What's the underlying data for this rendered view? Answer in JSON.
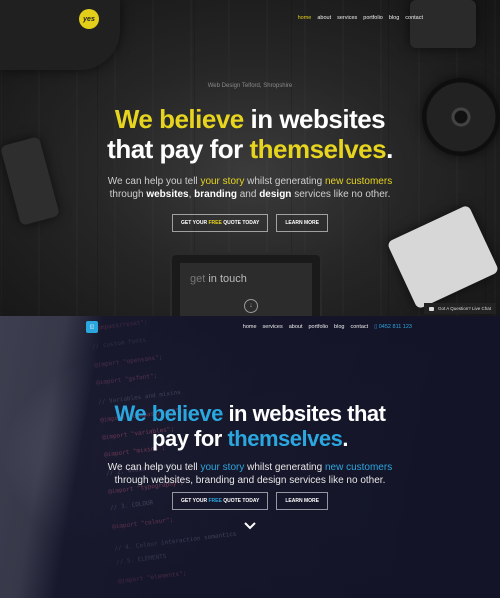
{
  "top": {
    "logo_text": "yes",
    "nav": [
      "home",
      "about",
      "services",
      "portfolio",
      "blog",
      "contact"
    ],
    "small_tagline": "Web Design Telford, Shropshire",
    "headline": {
      "hl1": "We believe",
      "t1": " in websites",
      "t2": "that pay for ",
      "hl2": "themselves",
      "t3": "."
    },
    "sub": {
      "a": "We can help you tell ",
      "hl1": "your story",
      "b": " whilst generating ",
      "hl2": "new customers",
      "c": "through ",
      "d": "websites",
      ",": ", ",
      "e": "branding",
      "f": " and ",
      "g": "design",
      "h": " services like no other."
    },
    "btn1": {
      "a": "GET YOUR ",
      "hl": "FREE",
      "b": " QUOTE TODAY"
    },
    "btn2": "LEARN MORE",
    "tablet": {
      "a": "get ",
      "b": "in touch",
      "icon": "↓"
    },
    "chat": "Got A Question? Live Chat",
    "accent": "#e6d41e"
  },
  "bottom": {
    "nav": [
      "home",
      "services",
      "about",
      "portfolio",
      "blog",
      "contact"
    ],
    "phone": "0452 811 123",
    "headline": {
      "hl1": "We believe",
      "t1": " in websites that",
      "t2": "pay for ",
      "hl2": "themselves",
      "t3": "."
    },
    "sub": {
      "a": "We can help you tell ",
      "hl1": "your story",
      "b": " whilst generating ",
      "hl2": "new customers",
      "c": "through websites, branding and design services like no other."
    },
    "btn1": {
      "a": "GET YOUR ",
      "hl": "FREE",
      "b": " QUOTE TODAY"
    },
    "btn2": "LEARN MORE",
    "accent": "#2ba7e0",
    "code_lines": [
      {
        "t": "#compass/reset\";",
        "c": "#e26a8e"
      },
      {
        "t": "// custom fonts",
        "c": "#7f86a3"
      },
      {
        "t": "@import \"opensans\";",
        "c": "#d66c9d"
      },
      {
        "t": "@import \"gsfont\";",
        "c": "#d66c9d"
      },
      {
        "t": "// Variables and mixins",
        "c": "#7f86a3"
      },
      {
        "t": "@import \"compass/css3\";",
        "c": "#e26a8e"
      },
      {
        "t": "@import \"variables\";",
        "c": "#e26a8e"
      },
      {
        "t": "@import \"mixins\";",
        "c": "#e26a8e"
      },
      {
        "t": "// 2. Global layout",
        "c": "#7f86a3"
      },
      {
        "t": "@import \"typography\";",
        "c": "#e26a8e"
      },
      {
        "t": "// 3. COLOUR",
        "c": "#7f86a3"
      },
      {
        "t": "@import \"colour\";",
        "c": "#e26a8e"
      },
      {
        "t": "// 4. Colour interaction semantics",
        "c": "#7f86a3"
      },
      {
        "t": "// 5. ELEMENTS",
        "c": "#7f86a3"
      },
      {
        "t": "@import \"elements\";",
        "c": "#e26a8e"
      }
    ]
  }
}
